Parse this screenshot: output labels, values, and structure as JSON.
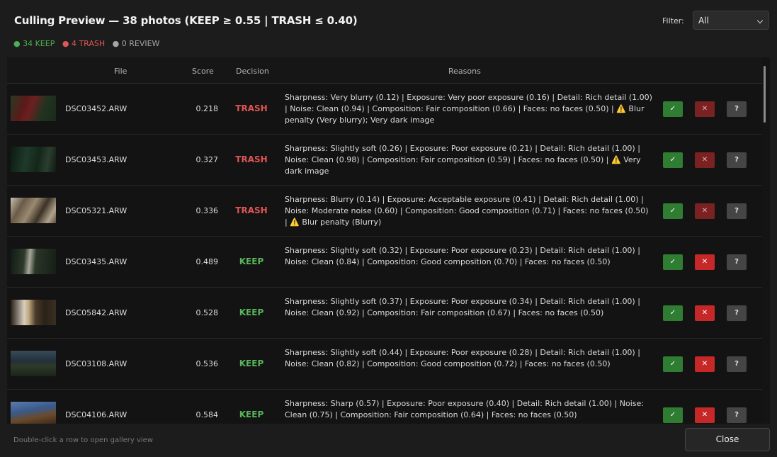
{
  "header": {
    "title": "Culling Preview — 38 photos   (KEEP ≥ 0.55  |  TRASH ≤ 0.40)",
    "stats": {
      "keep": "● 34 KEEP",
      "trash": "● 4 TRASH",
      "review": "● 0 REVIEW"
    },
    "filter_label": "Filter:",
    "filter_value": "All"
  },
  "table": {
    "columns": {
      "file": "File",
      "score": "Score",
      "decision": "Decision",
      "reasons": "Reasons"
    },
    "rows": [
      {
        "file": "DSC03452.ARW",
        "score": "0.218",
        "decision": "TRASH",
        "reasons": "Sharpness: Very blurry (0.12)  |  Exposure: Very poor exposure (0.16)  |  Detail: Rich detail (1.00)  |  Noise: Clean (0.94)  |  Composition: Fair composition (0.66)  |  Faces: no faces (0.50)  |  ⚠️ Blur penalty (Very blurry); Very dark image"
      },
      {
        "file": "DSC03453.ARW",
        "score": "0.327",
        "decision": "TRASH",
        "reasons": "Sharpness: Slightly soft (0.26)  |  Exposure: Poor exposure (0.21)  |  Detail: Rich detail (1.00)  |  Noise: Clean (0.98)  |  Composition: Fair composition (0.59)  |  Faces: no faces (0.50)  |  ⚠️ Very dark image"
      },
      {
        "file": "DSC05321.ARW",
        "score": "0.336",
        "decision": "TRASH",
        "reasons": "Sharpness: Blurry (0.14)  |  Exposure: Acceptable exposure (0.41)  |  Detail: Rich detail (1.00)  |  Noise: Moderate noise (0.60)  |  Composition: Good composition (0.71)  |  Faces: no faces (0.50)  |  ⚠️ Blur penalty (Blurry)"
      },
      {
        "file": "DSC03435.ARW",
        "score": "0.489",
        "decision": "KEEP",
        "reasons": "Sharpness: Slightly soft (0.32)  |  Exposure: Poor exposure (0.23)  |  Detail: Rich detail (1.00)  |  Noise: Clean (0.84)  |  Composition: Good composition (0.70)  |  Faces: no faces (0.50)"
      },
      {
        "file": "DSC05842.ARW",
        "score": "0.528",
        "decision": "KEEP",
        "reasons": "Sharpness: Slightly soft (0.37)  |  Exposure: Poor exposure (0.34)  |  Detail: Rich detail (1.00)  |  Noise: Clean (0.92)  |  Composition: Fair composition (0.67)  |  Faces: no faces (0.50)"
      },
      {
        "file": "DSC03108.ARW",
        "score": "0.536",
        "decision": "KEEP",
        "reasons": "Sharpness: Slightly soft (0.44)  |  Exposure: Poor exposure (0.28)  |  Detail: Rich detail (1.00)  |  Noise: Clean (0.82)  |  Composition: Good composition (0.72)  |  Faces: no faces (0.50)"
      },
      {
        "file": "DSC04106.ARW",
        "score": "0.584",
        "decision": "KEEP",
        "reasons": "Sharpness: Sharp (0.57)  |  Exposure: Poor exposure (0.40)  |  Detail: Rich detail (1.00)  |  Noise: Clean (0.75)  |  Composition: Fair composition (0.64)  |  Faces: no faces (0.50)"
      }
    ],
    "row_buttons": {
      "keep": "✓",
      "trash": "✕",
      "review": "?"
    }
  },
  "footer": {
    "hint": "Double-click a row to open gallery view",
    "close_label": "Close"
  },
  "colors": {
    "keep": "#58b65a",
    "trash": "#e05555",
    "review": "#a5a5a5",
    "keep_button": "#2e7d32",
    "trash_button": "#c62828"
  },
  "icons": {
    "filter_dropdown": "chevron-down-icon",
    "keep": "check-icon",
    "trash": "x-icon",
    "review": "question-icon",
    "warning": "warning-icon"
  }
}
